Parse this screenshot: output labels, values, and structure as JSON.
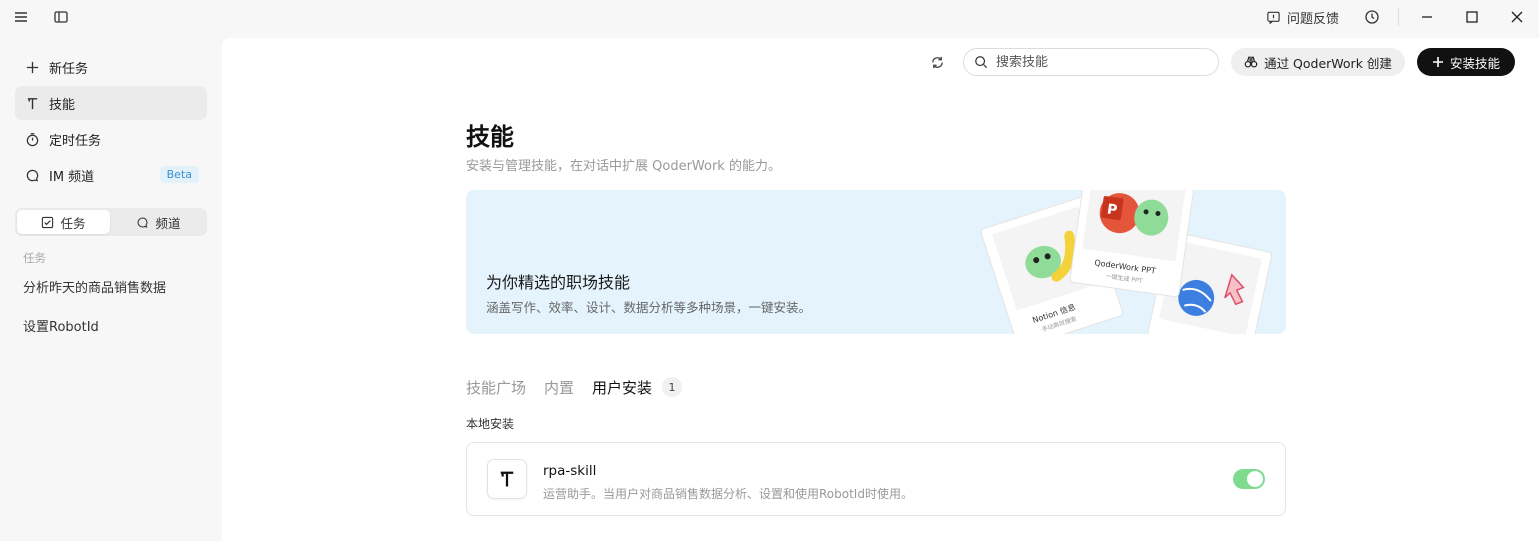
{
  "titlebar": {
    "feedback_label": "问题反馈"
  },
  "sidebar": {
    "items": [
      {
        "label": "新任务",
        "icon": "plus-icon"
      },
      {
        "label": "技能",
        "icon": "skill-icon"
      },
      {
        "label": "定时任务",
        "icon": "timer-icon"
      },
      {
        "label": "IM 频道",
        "icon": "chat-icon",
        "badge": "Beta"
      }
    ],
    "segment": {
      "tasks_label": "任务",
      "channels_label": "频道"
    },
    "section_label": "任务",
    "tasks": [
      "分析昨天的商品销售数据",
      "设置RobotId"
    ]
  },
  "toolbar": {
    "search_placeholder": "搜索技能",
    "create_label": "通过 QoderWork 创建",
    "install_label": "安装技能"
  },
  "page": {
    "title": "技能",
    "subtitle": "安装与管理技能，在对话中扩展 QoderWork 的能力。"
  },
  "banner": {
    "title": "为你精选的职场技能",
    "subtitle": "涵盖写作、效率、设计、数据分析等多种场景，一键安装。",
    "card_left_title": "Notion 信息",
    "card_left_sub": "手动高效搜索",
    "card_mid_title": "QoderWork PPT",
    "card_mid_sub": "一键生成 PPT"
  },
  "tabs": {
    "items": [
      "技能广场",
      "内置",
      "用户安装"
    ],
    "active_count": "1"
  },
  "local": {
    "group_label": "本地安装",
    "skills": [
      {
        "name": "rpa-skill",
        "desc": "运营助手。当用户对商品销售数据分析、设置和使用RobotId时使用。",
        "enabled": true
      }
    ]
  },
  "colors": {
    "accent_black": "#111111",
    "banner_bg": "#e4f3fc",
    "toggle_on": "#7fdc8f",
    "beta_bg": "#e3f1fb",
    "beta_text": "#3a8fd2"
  }
}
